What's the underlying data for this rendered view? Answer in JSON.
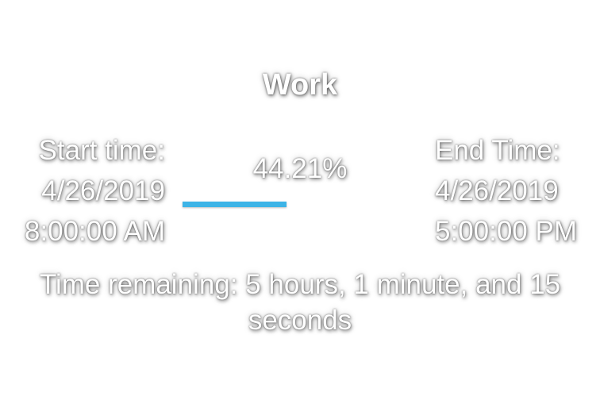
{
  "title": "Work",
  "start": {
    "label": "Start time:",
    "date": "4/26/2019",
    "time": "8:00:00 AM"
  },
  "end": {
    "label": "End Time:",
    "date": "4/26/2019",
    "time": "5:00:00 PM"
  },
  "progress": {
    "percent_text": "44.21%",
    "fraction": 0.4421,
    "color": "#3db4e7"
  },
  "remaining_text": "Time remaining: 5 hours, 1 minute, and 15 seconds"
}
